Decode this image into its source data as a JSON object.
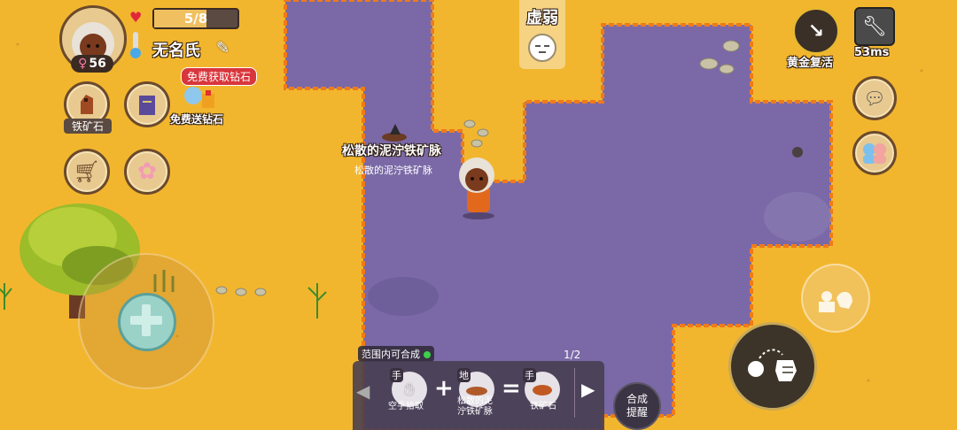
{
  "player": {
    "gender_symbol": "♀",
    "age": "56",
    "health": "5/8",
    "name": "无名氏"
  },
  "promo": {
    "badge": "免费获取钻石",
    "label": "免费送钻石"
  },
  "inventory_shortcut": {
    "label": "铁矿石"
  },
  "status": {
    "label": "虚弱"
  },
  "top_right": {
    "revive_label": "黄金复活",
    "ping": "53ms"
  },
  "world_labels": {
    "vein_name": "松散的泥泞铁矿脉",
    "vein_sub": "松散的泥泞铁矿脉"
  },
  "crafting": {
    "range_label": "范围内可合成",
    "page": "1/2",
    "slot1_tag": "手",
    "slot1_label": "空手拾取",
    "slot2_tag": "地",
    "slot2_label_line1": "松散的泥",
    "slot2_label_line2": "泞铁矿脉",
    "slot3_tag": "手",
    "slot3_label": "铁矿石",
    "plus": "+",
    "equals": "=",
    "remind_line1": "合成",
    "remind_line2": "提醒"
  },
  "colors": {
    "sand": "#f2b62e",
    "swamp": "#7a69a6",
    "fire_edge": "#f07a1a",
    "panel": "#463c50"
  }
}
